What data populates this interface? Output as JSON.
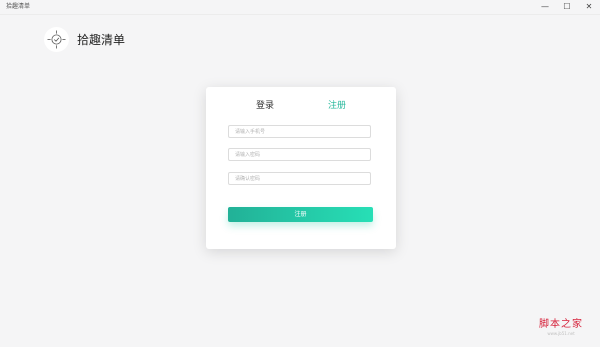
{
  "window": {
    "title": "拾趣清单",
    "controls": {
      "minimize": "—",
      "maximize": "☐",
      "close": "✕"
    }
  },
  "brand": {
    "logo_icon": "target-check-icon",
    "name": "拾趣清单"
  },
  "tabs": [
    {
      "label": "登录",
      "active": false
    },
    {
      "label": "注册",
      "active": true
    }
  ],
  "form": {
    "phone_placeholder": "请输入手机号",
    "password_placeholder": "请输入密码",
    "confirm_placeholder": "请确认密码",
    "submit_label": "注册"
  },
  "colors": {
    "accent": "#25b79a",
    "accent_gradient_end": "#27dfb6",
    "background": "#f5f5f6"
  },
  "watermark": {
    "text": "脚本之家",
    "url": "www.jb51.net"
  }
}
